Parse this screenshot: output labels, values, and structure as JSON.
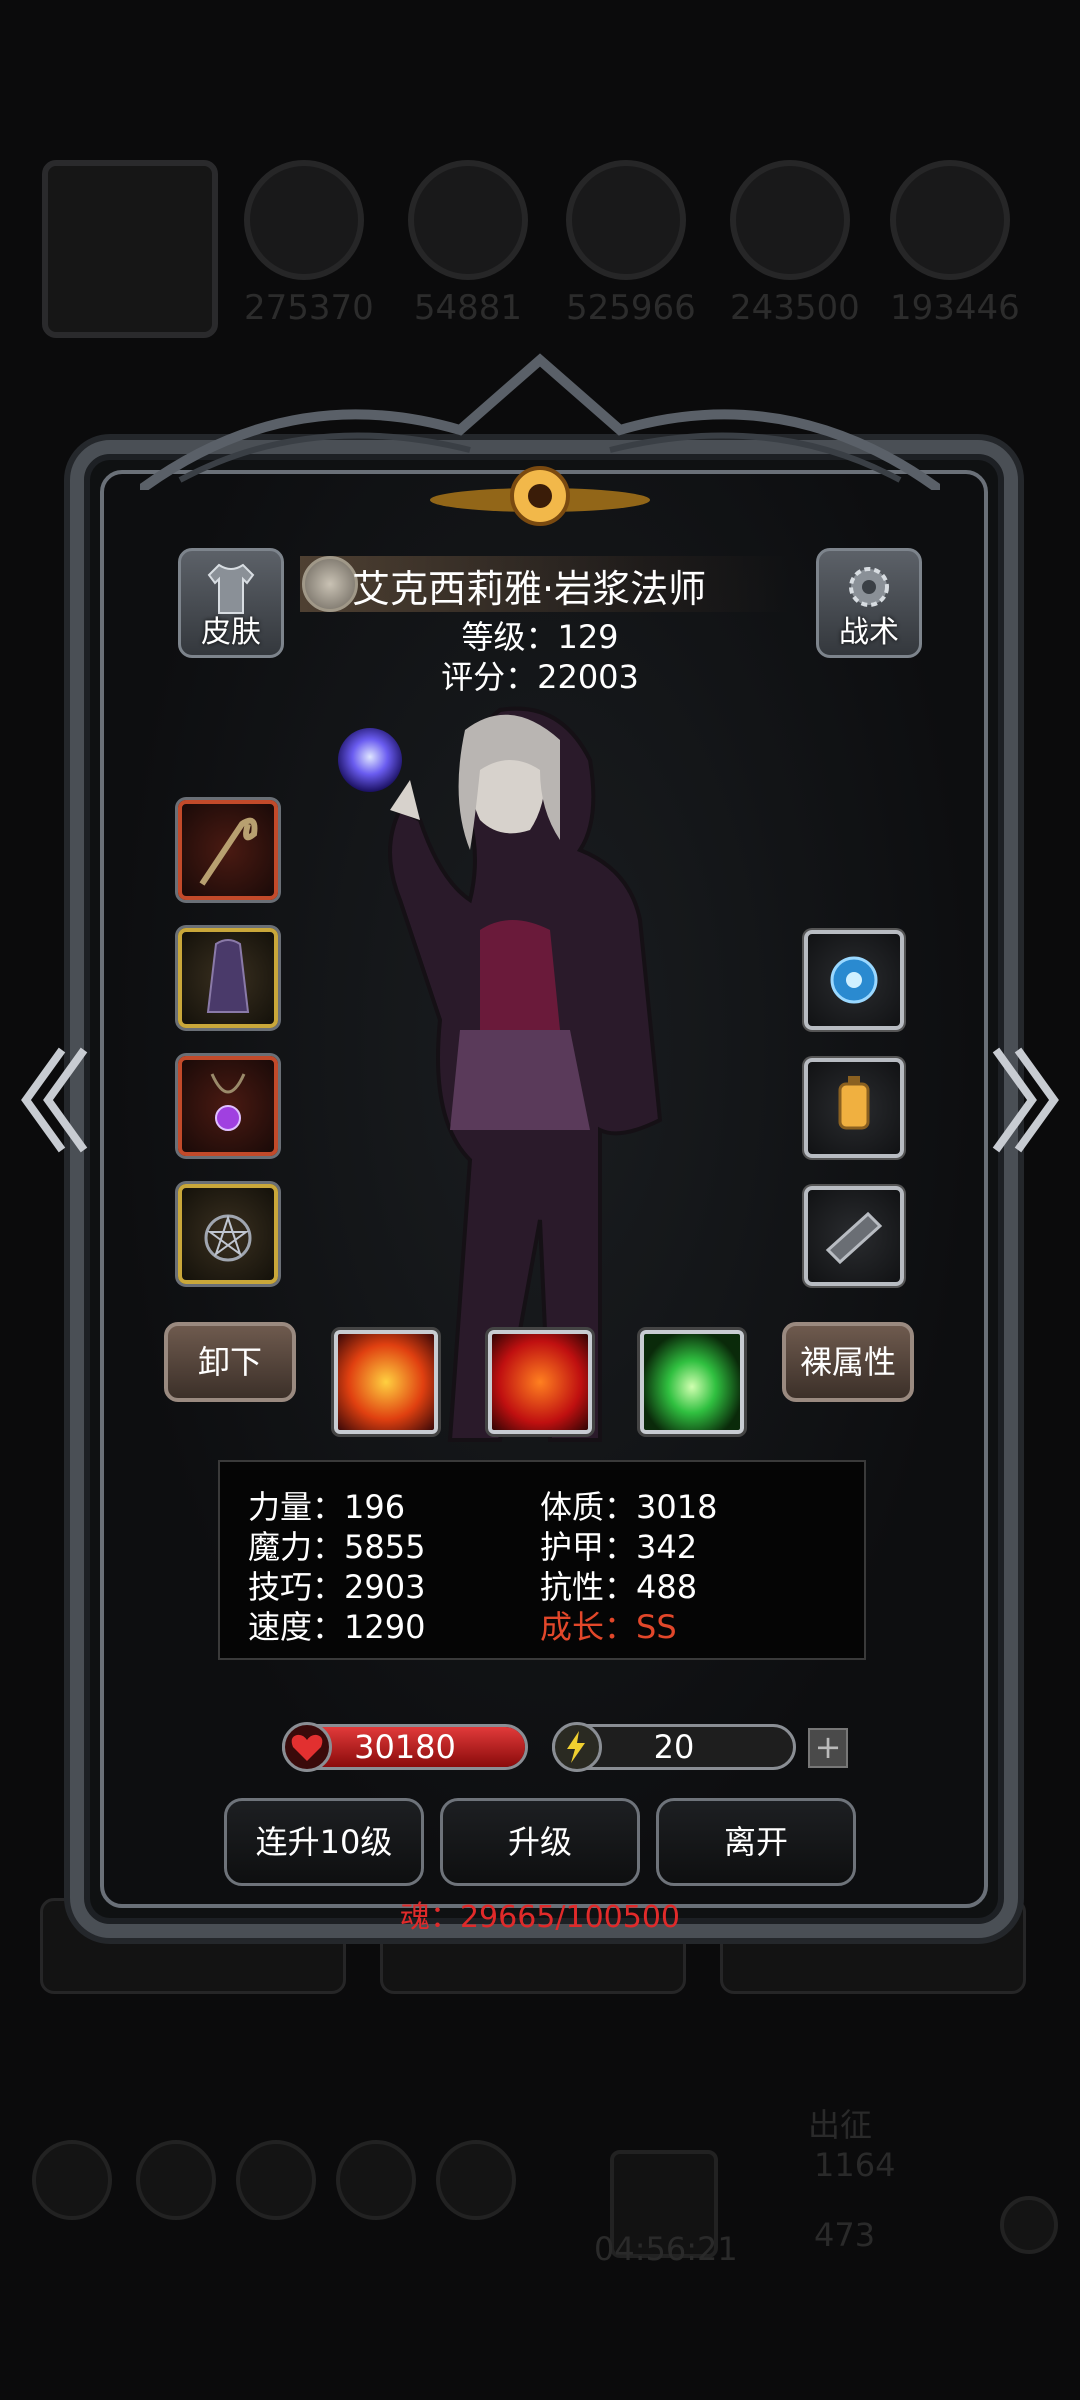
{
  "background": {
    "resources": [
      "275370",
      "54881",
      "525966",
      "243500",
      "193446"
    ],
    "timer": "04:56:21",
    "march_label": "出征",
    "march_count": "1164",
    "gem_count": "473"
  },
  "header": {
    "skin_button": "皮肤",
    "tactics_button": "战术",
    "hero_name": "艾克西莉雅·岩浆法师",
    "level_text": "等级：129",
    "score_text": "评分：22003"
  },
  "equipment": {
    "left": [
      "weapon-staff",
      "armor-robe",
      "amulet-purple",
      "pentagram-medallion"
    ],
    "right": [
      "orb-accessory",
      "lantern-accessory",
      "bracer-accessory"
    ]
  },
  "controls": {
    "unequip_button": "卸下",
    "base_attr_button": "裸属性"
  },
  "skills": [
    "fire-burst-skill",
    "flame-skill",
    "green-light-skill"
  ],
  "stats": {
    "strength": "力量：196",
    "magic": "魔力：5855",
    "skill": "技巧：2903",
    "speed": "速度：1290",
    "constitution": "体质：3018",
    "armor": "护甲：342",
    "resistance": "抗性：488",
    "growth": "成长：SS"
  },
  "bars": {
    "hp_value": "30180",
    "hp_fill": 1.0,
    "energy_value": "20",
    "energy_fill": 0.15
  },
  "actions": {
    "level_up_10": "连升10级",
    "level_up": "升级",
    "leave": "离开"
  },
  "soul_text": "魂：29665/100500",
  "colors": {
    "growth": "#e2472a",
    "soul": "#e02a2a",
    "hp": "#e13a3a",
    "energy": "#f0da3a"
  }
}
